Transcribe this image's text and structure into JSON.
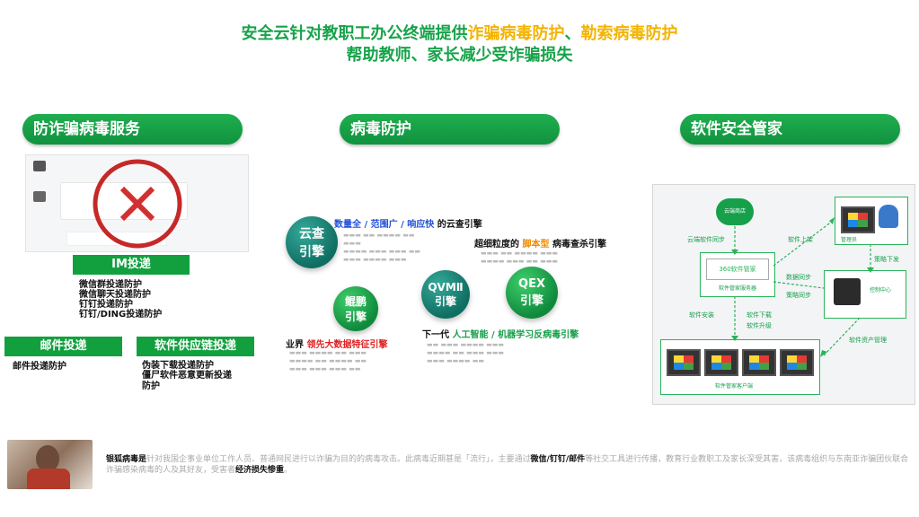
{
  "header": {
    "line1_prefix": "安全云针对教职工办公终端提供",
    "line1_highlight1": "诈骗病毒防护",
    "line1_sep": "、",
    "line1_highlight2": "勒索病毒防护",
    "line2": "帮助教师、家长减少受诈骗损失"
  },
  "sections": {
    "fraud": {
      "title": "防诈骗病毒服务",
      "im_title": "IM投递",
      "im_items": [
        "微信群投递防护",
        "微信聊天投递防护",
        "钉钉投递防护",
        "钉钉/DING投递防护"
      ],
      "mail_title": "邮件投递",
      "mail_items": [
        "邮件投递防护"
      ],
      "supply_title": "软件供应链投递",
      "supply_items": [
        "伪装下载投递防护",
        "僵尸软件恶意更新投递防护"
      ]
    },
    "virus": {
      "title": "病毒防护",
      "cloud_engine": "云查引擎",
      "cloud_desc_b": "数量全 / 范围广 / 响应快",
      "cloud_desc": " 的云查引擎",
      "script_desc_pre": "超细粒度的 ",
      "script_desc_o": "脚本型",
      "script_desc_post": " 病毒查杀引擎",
      "kunpeng_engine": "鲲鹏引擎",
      "qvm_engine": "QVMⅡ引擎",
      "qex_engine": "QEX引擎",
      "industry_pre": "业界 ",
      "industry_r": "领先大数据特征引擎",
      "nextgen_pre": "下一代 ",
      "nextgen_g": "人工智能 / 机器学习反病毒引擎"
    },
    "steward": {
      "title": "软件安全管家",
      "cloud_label": "云端商店",
      "product": "360软件管家",
      "server_label": "软件管家服务器",
      "client_label": "软件管家客户端",
      "admin_label": "管理员",
      "center_label": "控制中心",
      "arrows": [
        "云端软件同步",
        "软件上架",
        "策略下发",
        "数据同步",
        "策略同步",
        "软件安装",
        "软件下载",
        "软件升级",
        "软件资产管理"
      ]
    }
  },
  "footer": {
    "term": "银狐病毒是",
    "text1": "针对我国企事业单位工作人员、普通网民进行以诈骗为目的的病毒攻击。此病毒近期甚是「流行」，主要通过",
    "bold1": "微信/钉钉/邮件",
    "text2": "等社交工具进行传播，教育行业教职工及家长深受其害，该病毒组织与东南亚诈骗团伙联合诈骗感染病毒的人及其好友，受害者",
    "bold2": "经济损失惨重",
    "end": "。"
  },
  "colors": {
    "accent_green": "#16a34a",
    "highlight": "#f3b300",
    "button_green": "#12a03f"
  }
}
